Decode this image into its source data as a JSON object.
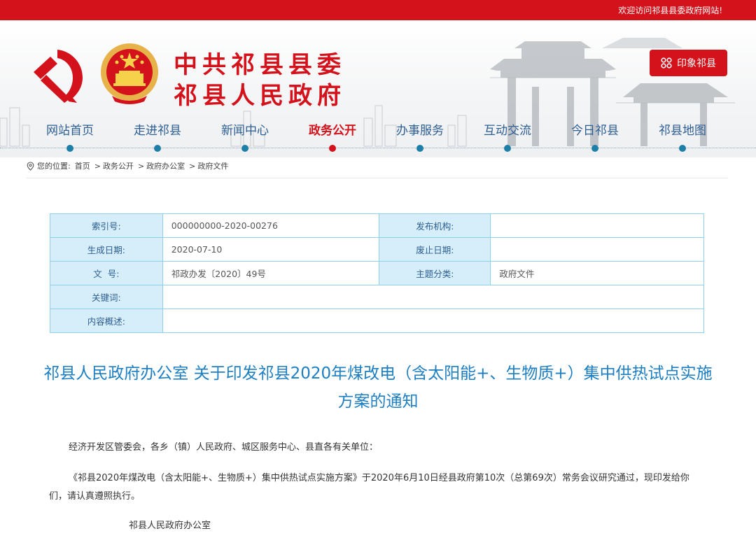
{
  "topbar": {
    "welcome": "欢迎访问祁县县委政府网站!"
  },
  "header": {
    "title_line1": "中共祁县县委",
    "title_line2": "祁县人民政府",
    "impression_button": "印象祁县"
  },
  "nav": {
    "items": [
      {
        "label": "网站首页"
      },
      {
        "label": "走进祁县"
      },
      {
        "label": "新闻中心"
      },
      {
        "label": "政务公开"
      },
      {
        "label": "办事服务"
      },
      {
        "label": "互动交流"
      },
      {
        "label": "今日祁县"
      },
      {
        "label": "祁县地图"
      }
    ],
    "active": "政务公开"
  },
  "breadcrumb": {
    "prefix": "您的位置:",
    "items": [
      "首页",
      "政务公开",
      "政府办公室",
      "政府文件"
    ],
    "separator": ">"
  },
  "meta": {
    "index_no_label": "索引号:",
    "index_no": "000000000-2020-00276",
    "publisher_label": "发布机构:",
    "publisher": "",
    "created_label": "生成日期:",
    "created": "2020-07-10",
    "expire_label": "废止日期:",
    "expire": "",
    "doc_no_label": "文  号:",
    "doc_no": "祁政办发〔2020〕49号",
    "category_label": "主题分类:",
    "category": "政府文件",
    "keywords_label": "关键词:",
    "keywords": "",
    "summary_label": "内容概述:",
    "summary": ""
  },
  "article": {
    "title": "祁县人民政府办公室 关于印发祁县2020年煤改电（含太阳能+、生物质+）集中供热试点实施方案的通知",
    "para1": "经济开发区管委会，各乡（镇）人民政府、城区服务中心、县直各有关单位：",
    "para2": "《祁县2020年煤改电（含太阳能+、生物质+）集中供热试点实施方案》于2020年6月10日经县政府第10次（总第69次）常务会议研究通过，现印发给你们，请认真遵照执行。",
    "signature": "祁县人民政府办公室"
  },
  "colors": {
    "brand_red": "#d3121b",
    "nav_blue": "#2d5e92",
    "title_blue": "#1d7fc2",
    "table_bg": "#d6eef9"
  }
}
